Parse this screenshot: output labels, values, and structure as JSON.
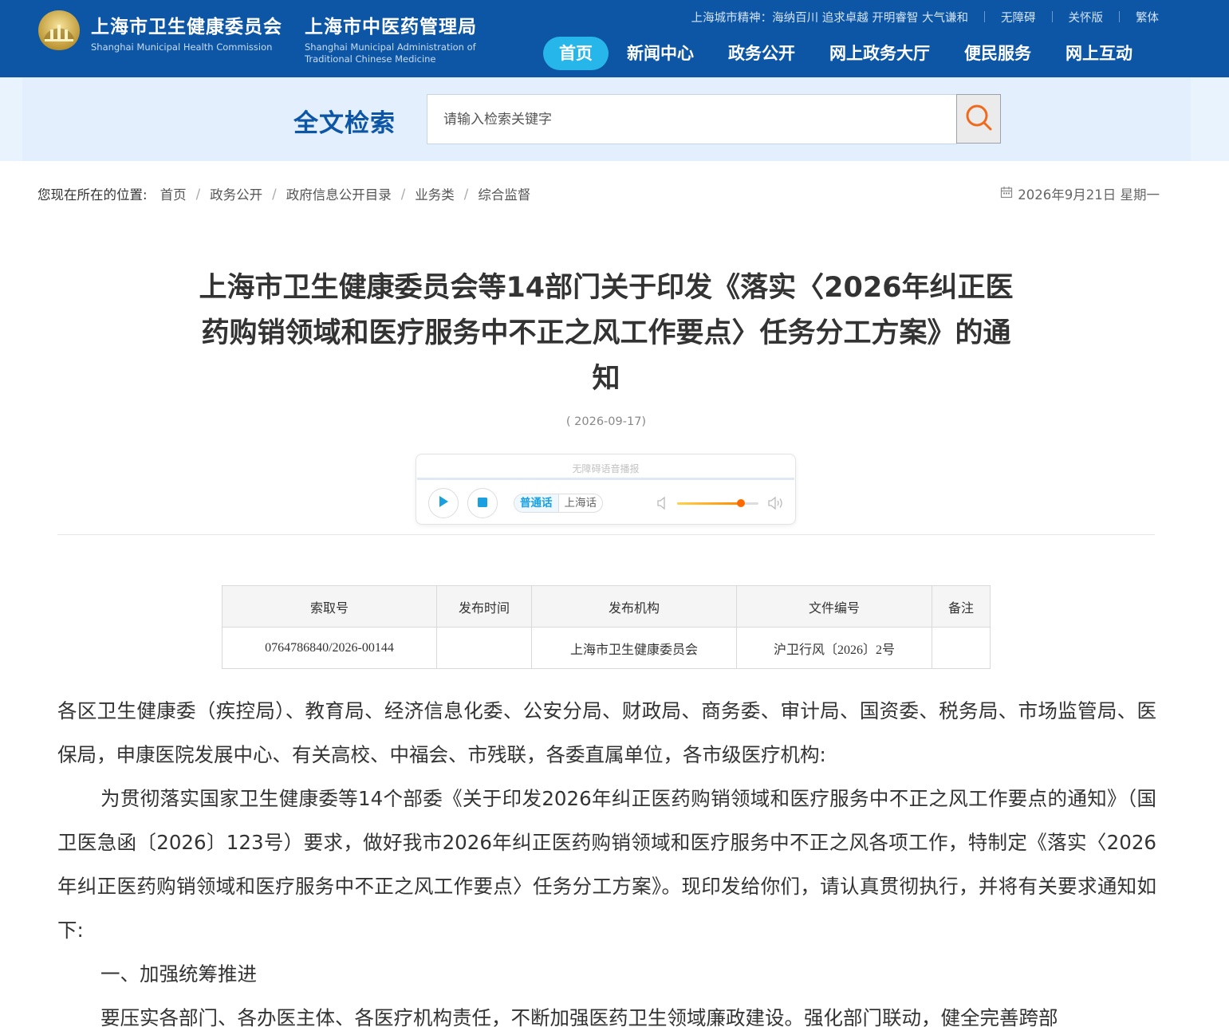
{
  "header": {
    "org1_cn": "上海市卫生健康委员会",
    "org1_en": "Shanghai Municipal Health Commission",
    "org2_cn": "上海市中医药管理局",
    "org2_en_line1": "Shanghai Municipal Administration of",
    "org2_en_line2": "Traditional Chinese Medicine",
    "slogan": "上海城市精神：海纳百川 追求卓越 开明睿智 大气谦和",
    "accessibility": "无障碍",
    "care_mode": "关怀版",
    "traditional": "繁体",
    "nav": [
      {
        "label": "首页",
        "active": true
      },
      {
        "label": "新闻中心",
        "active": false
      },
      {
        "label": "政务公开",
        "active": false
      },
      {
        "label": "网上政务大厅",
        "active": false
      },
      {
        "label": "便民服务",
        "active": false
      },
      {
        "label": "网上互动",
        "active": false
      }
    ],
    "colors": {
      "header_bg": "#0c56a5",
      "active_nav": "#27b6ea"
    }
  },
  "search": {
    "title": "全文检索",
    "placeholder": "请输入检索关键字",
    "button_icon": "search-icon"
  },
  "breadcrumb": {
    "label": "您现在所在的位置:",
    "items": [
      "首页",
      "政务公开",
      "政府信息公开目录",
      "业务类",
      "综合监督"
    ]
  },
  "current_date": "2026年9月21日 星期一",
  "article": {
    "title_line1": "上海市卫生健康委员会等14部门关于印发《落实〈2026年纠正医",
    "title_line2": "药购销领域和医疗服务中不正之风工作要点〉任务分工方案》的通",
    "title_line3": "知",
    "date": "( 2026-09-17)"
  },
  "player": {
    "title": "无障碍语音播报",
    "lang_mandarin": "普通话",
    "lang_shanghainese": "上海话",
    "volume": 0.78
  },
  "meta_table": {
    "headers": [
      "索取号",
      "发布时间",
      "发布机构",
      "文件编号",
      "备注"
    ],
    "row": [
      "0764786840/2026-00144",
      "",
      "上海市卫生健康委员会",
      "沪卫行风〔2026〕2号",
      ""
    ]
  },
  "body": {
    "recipients": "各区卫生健康委（疾控局）、教育局、经济信息化委、公安分局、财政局、商务委、审计局、国资委、税务局、市场监管局、医保局，申康医院发展中心、有关高校、中福会、市残联，各委直属单位，各市级医疗机构:",
    "para1": "为贯彻落实国家卫生健康委等14个部委《关于印发2026年纠正医药购销领域和医疗服务中不正之风工作要点的通知》（国卫医急函〔2026〕123号）要求，做好我市2026年纠正医药购销领域和医疗服务中不正之风各项工作，特制定《落实〈2026年纠正医药购销领域和医疗服务中不正之风工作要点〉任务分工方案》。现印发给你们，请认真贯彻执行，并将有关要求通知如下:",
    "heading1": "一、加强统筹推进",
    "para2": "要压实各部门、各办医主体、各医疗机构责任，不断加强医药卫生领域廉政建设。强化部门联动，健全完善跨部"
  }
}
